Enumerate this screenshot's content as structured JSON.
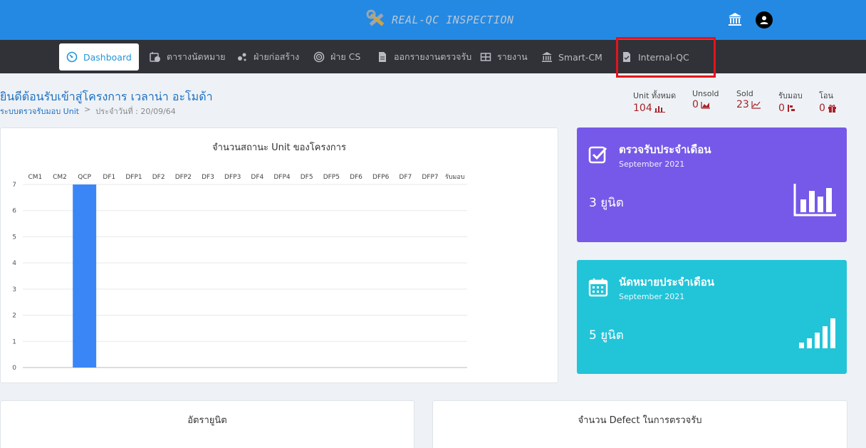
{
  "header": {
    "app_title": "REAL-QC INSPECTION",
    "brand_color": "#2489e3"
  },
  "nav": {
    "items": [
      {
        "label": "Dashboard",
        "icon": "dashboard-gauge-icon",
        "active": true
      },
      {
        "label": "ตารางนัดหมาย",
        "icon": "calendar-clock-icon"
      },
      {
        "label": "ฝ่ายก่อสร้าง",
        "icon": "construction-icon"
      },
      {
        "label": "ฝ่าย CS",
        "icon": "target-icon"
      },
      {
        "label": "ออกรายงานตรวจรับ",
        "icon": "document-icon"
      },
      {
        "label": "รายงาน",
        "icon": "table-icon"
      },
      {
        "label": "Smart-CM",
        "icon": "bank-icon"
      },
      {
        "label": "Internal-QC",
        "icon": "file-check-icon"
      }
    ]
  },
  "welcome": {
    "title": "ยินดีต้อนรับเข้าสู่โครงการ เวลาน่า อะโมด้า",
    "breadcrumb_link": "ระบบตรวจรับมอบ Unit",
    "breadcrumb_sep": ">",
    "breadcrumb_date": "ประจำวันที่ : 20/09/64"
  },
  "stats": [
    {
      "label": "Unit ทั้งหมด",
      "value": "104",
      "icon": "bar-chart-icon"
    },
    {
      "label": "Unsold",
      "value": "0",
      "icon": "area-chart-icon"
    },
    {
      "label": "Sold",
      "value": "23",
      "icon": "line-chart-icon"
    },
    {
      "label": "รับมอบ",
      "value": "0",
      "icon": "handover-icon"
    },
    {
      "label": "โอน",
      "value": "0",
      "icon": "gift-icon"
    }
  ],
  "chart_data": {
    "type": "bar",
    "title": "จำนวนสถานะ Unit ของโครงการ",
    "categories": [
      "CM1",
      "CM2",
      "QCP",
      "DF1",
      "DFP1",
      "DF2",
      "DFP2",
      "DF3",
      "DFP3",
      "DF4",
      "DFP4",
      "DF5",
      "DFP5",
      "DF6",
      "DFP6",
      "DF7",
      "DFP7",
      "รับมอบ"
    ],
    "values": [
      0,
      0,
      7,
      0,
      0,
      0,
      0,
      0,
      0,
      0,
      0,
      0,
      0,
      0,
      0,
      0,
      0,
      0
    ],
    "ylim": [
      0,
      7
    ],
    "yticks": [
      "0",
      "1",
      "2",
      "3",
      "4",
      "5",
      "6",
      "7"
    ],
    "bar_color": "#3b86f7",
    "grid": true
  },
  "cards": {
    "inspect": {
      "title": "ตรวจรับประจำเดือน",
      "subtitle": "September 2021",
      "count": "3 ยูนิต",
      "color": "#7659e8"
    },
    "appointment": {
      "title": "นัดหมายประจำเดือน",
      "subtitle": "September 2021",
      "count": "5 ยูนิต",
      "color": "#22c4d8"
    }
  },
  "bottom_panels": {
    "left_title": "อัตรายูนิต",
    "right_title": "จำนวน Defect ในการตรวจรับ"
  }
}
